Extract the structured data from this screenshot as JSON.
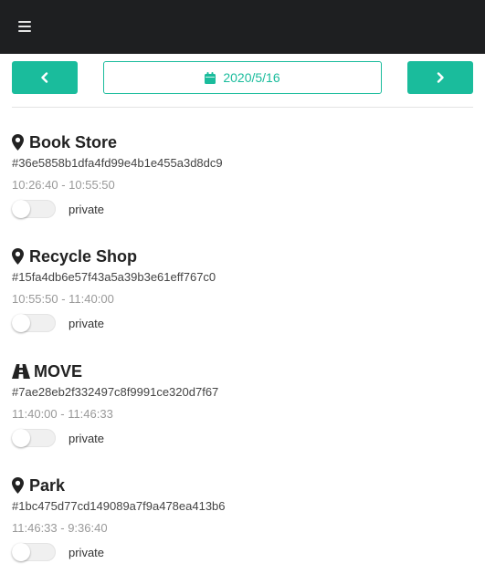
{
  "colors": {
    "accent": "#1abc9c",
    "topbar": "#1e1f21"
  },
  "header": {
    "menu_icon": "hamburger-icon"
  },
  "nav": {
    "prev_icon": "chevron-left-icon",
    "next_icon": "chevron-right-icon",
    "date_icon": "calendar-icon",
    "date": "2020/5/16"
  },
  "entries": [
    {
      "icon": "map-marker-icon",
      "title": "Book Store",
      "id": "#36e5858b1dfa4fd99e4b1e455a3d8dc9",
      "time": "10:26:40 - 10:55:50",
      "private_label": "private",
      "private": false
    },
    {
      "icon": "map-marker-icon",
      "title": "Recycle Shop",
      "id": "#15fa4db6e57f43a5a39b3e61eff767c0",
      "time": "10:55:50 - 11:40:00",
      "private_label": "private",
      "private": false
    },
    {
      "icon": "road-icon",
      "title": "MOVE",
      "id": "#7ae28eb2f332497c8f9991ce320d7f67",
      "time": "11:40:00 - 11:46:33",
      "private_label": "private",
      "private": false
    },
    {
      "icon": "map-marker-icon",
      "title": "Park",
      "id": "#1bc475d77cd149089a7f9a478ea413b6",
      "time": "11:46:33 - 9:36:40",
      "private_label": "private",
      "private": false
    }
  ]
}
